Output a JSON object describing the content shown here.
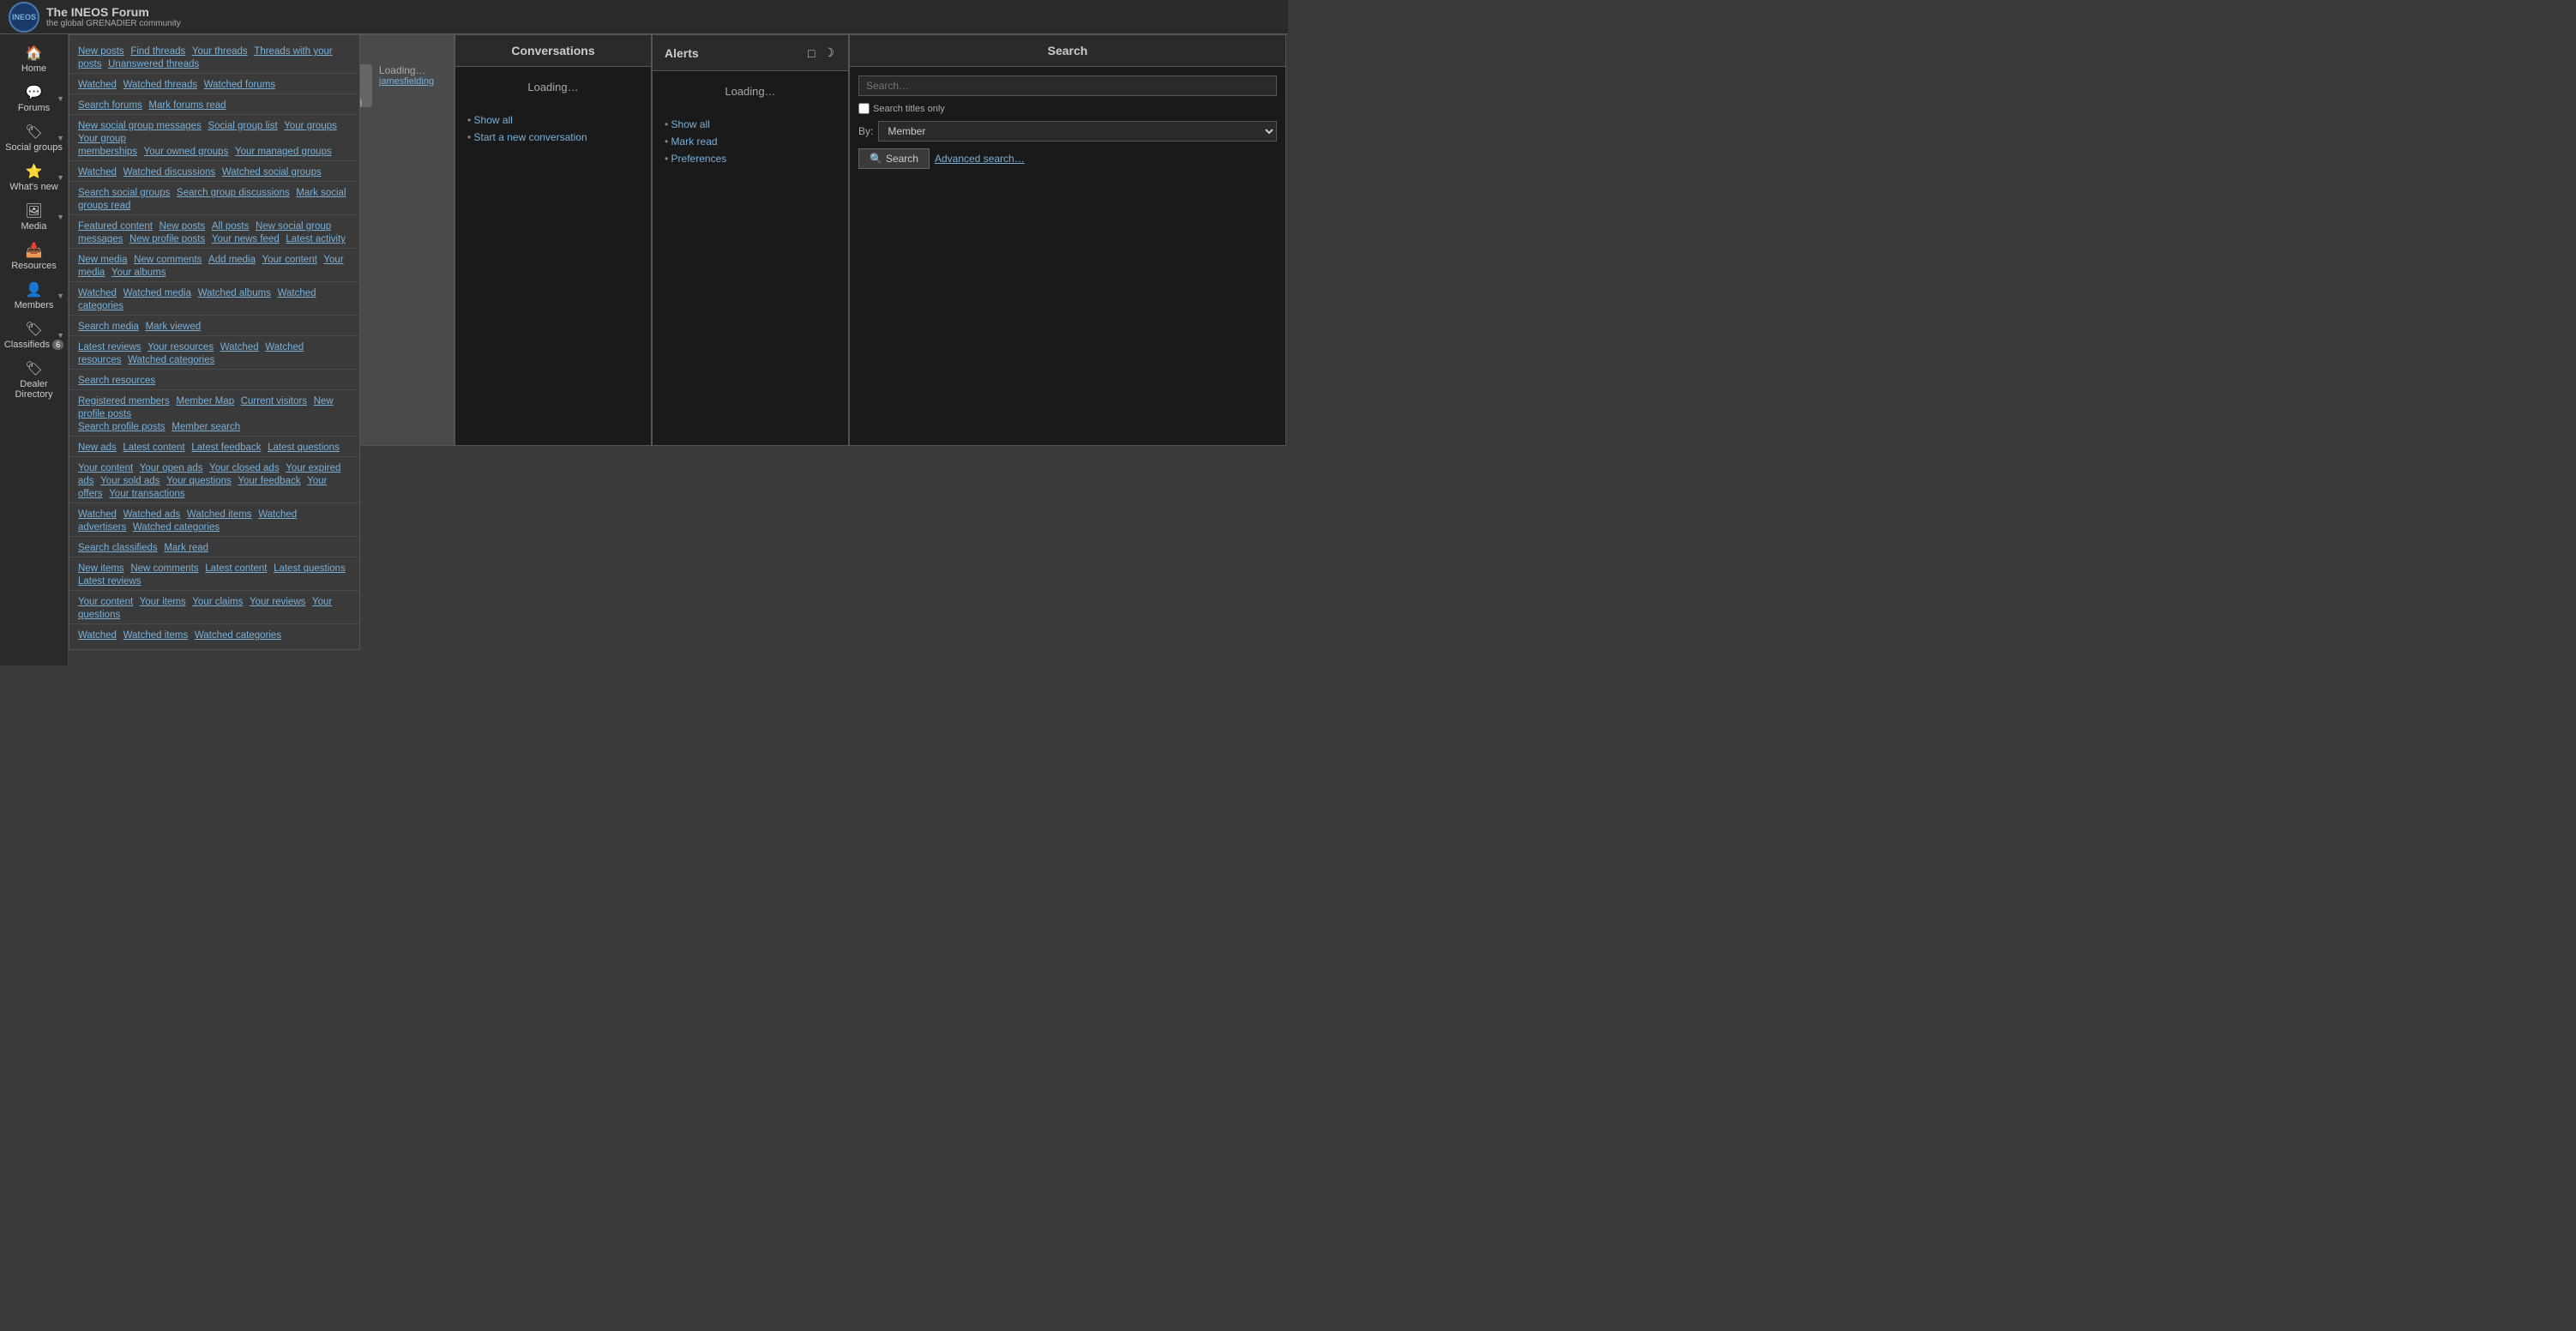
{
  "header": {
    "logo_text": "INEOS",
    "title": "The INEOS Forum",
    "subtitle": "the global GRENADIER community"
  },
  "sidebar": {
    "items": [
      {
        "id": "home",
        "icon": "🏠",
        "label": "Home",
        "has_arrow": false
      },
      {
        "id": "forums",
        "icon": "💬",
        "label": "Forums",
        "has_arrow": true
      },
      {
        "id": "social-groups",
        "icon": "🏷",
        "label": "Social groups",
        "has_arrow": true
      },
      {
        "id": "whats-new",
        "icon": "⭐",
        "label": "What's new",
        "has_arrow": true
      },
      {
        "id": "media",
        "icon": "🖼",
        "label": "Media",
        "has_arrow": true
      },
      {
        "id": "resources",
        "icon": "📥",
        "label": "Resources",
        "has_arrow": false
      },
      {
        "id": "members",
        "icon": "👤",
        "label": "Members",
        "has_arrow": true
      },
      {
        "id": "classifieds",
        "icon": "🏷",
        "label": "Classifieds 6",
        "has_arrow": true,
        "badge": "6"
      },
      {
        "id": "dealer-directory",
        "icon": "🏷",
        "label": "Dealer Directory",
        "has_arrow": false
      }
    ]
  },
  "forums_dropdown": {
    "sections": [
      {
        "links": [
          "New posts",
          "Find threads",
          "Your threads",
          "Threads with your posts",
          "Unanswered threads"
        ]
      },
      {
        "links": [
          "Watched",
          "Watched threads",
          "Watched forums"
        ]
      },
      {
        "links": [
          "Search forums",
          "Mark forums read"
        ]
      }
    ]
  },
  "social_groups_dropdown": {
    "sections": [
      {
        "links": [
          "New social group messages",
          "Social group list",
          "Your groups",
          "Your group memberships",
          "Your owned groups",
          "Your managed groups"
        ]
      },
      {
        "links": [
          "Watched",
          "Watched discussions",
          "Watched social groups"
        ]
      },
      {
        "links": [
          "Search social groups",
          "Search group discussions",
          "Mark social groups read"
        ]
      }
    ]
  },
  "whats_new_dropdown": {
    "sections": [
      {
        "links": [
          "Featured content",
          "New posts",
          "All posts",
          "New social group messages",
          "New profile posts",
          "Your news feed",
          "Latest activity"
        ]
      }
    ]
  },
  "media_dropdown": {
    "sections": [
      {
        "links": [
          "New media",
          "New comments",
          "Add media",
          "Your content",
          "Your media",
          "Your albums"
        ]
      },
      {
        "links": [
          "Watched",
          "Watched media",
          "Watched albums",
          "Watched categories"
        ]
      },
      {
        "links": [
          "Search media",
          "Mark viewed"
        ]
      }
    ]
  },
  "members_dropdown": {
    "sections": [
      {
        "links": [
          "Latest reviews",
          "Your resources",
          "Watched",
          "Watched resources",
          "Watched categories"
        ]
      },
      {
        "links": [
          "Search resources"
        ]
      },
      {
        "links": [
          "Registered members",
          "Member Map",
          "Current visitors",
          "New profile posts",
          "Search profile posts",
          "Member search"
        ]
      }
    ]
  },
  "classifieds_dropdown": {
    "sections": [
      {
        "links": [
          "New ads",
          "Latest content",
          "Latest feedback",
          "Latest questions"
        ]
      },
      {
        "links": [
          "Your content",
          "Your open ads",
          "Your closed ads",
          "Your expired ads",
          "Your sold ads",
          "Your questions",
          "Your feedback",
          "Your offers",
          "Your transactions"
        ]
      },
      {
        "links": [
          "Watched",
          "Watched ads",
          "Watched items",
          "Watched advertisers",
          "Watched categories"
        ]
      },
      {
        "links": [
          "Search classifieds",
          "Mark read"
        ]
      },
      {
        "links": [
          "New items",
          "New comments",
          "Latest content",
          "Latest questions",
          "Latest reviews"
        ]
      },
      {
        "links": [
          "Your content",
          "Your items",
          "Your claims",
          "Your reviews",
          "Your questions"
        ]
      },
      {
        "links": [
          "Watched",
          "Watched items",
          "Watched categories"
        ]
      }
    ]
  },
  "loading_panel": {
    "text": "Loading…",
    "user_name": "jamesfielding"
  },
  "conversations_panel": {
    "header": "Conversations",
    "loading_text": "Loading…",
    "links": [
      "Show all",
      "Start a new conversation"
    ]
  },
  "alerts_panel": {
    "header": "Alerts",
    "loading_text": "Loading…",
    "links": [
      "Show all",
      "Mark read",
      "Preferences"
    ],
    "icons": [
      "□",
      "☽"
    ]
  },
  "search_panel": {
    "header": "Search",
    "placeholder": "Search…",
    "checkbox_label": "Search titles only",
    "by_label": "By:",
    "by_options": [
      "Member"
    ],
    "search_button": "Search",
    "advanced_link": "Advanced search…"
  }
}
